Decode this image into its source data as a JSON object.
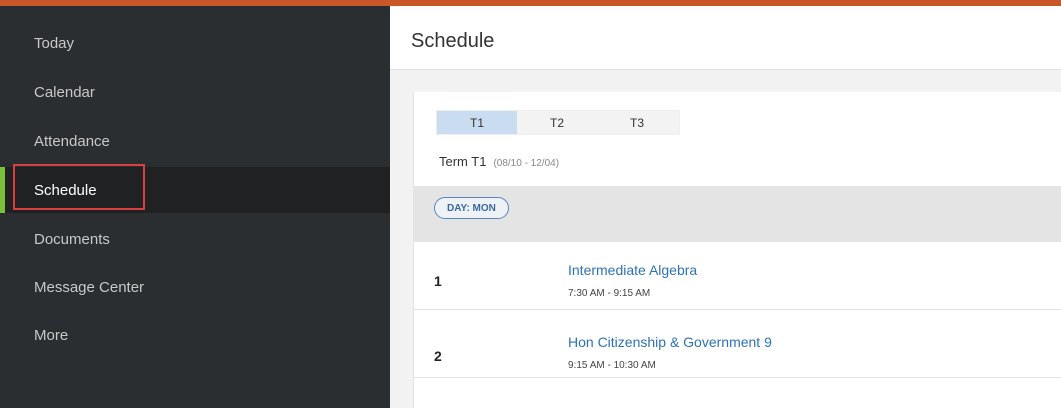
{
  "sidebar": {
    "items": [
      {
        "label": "Today"
      },
      {
        "label": "Calendar"
      },
      {
        "label": "Attendance"
      },
      {
        "label": "Schedule"
      },
      {
        "label": "Documents"
      },
      {
        "label": "Message Center"
      },
      {
        "label": "More"
      }
    ],
    "active_item": "Schedule"
  },
  "header": {
    "title": "Schedule"
  },
  "terms": {
    "tabs": [
      {
        "label": "T1"
      },
      {
        "label": "T2"
      },
      {
        "label": "T3"
      }
    ],
    "selected": "T1",
    "current_term_label": "Term T1",
    "current_term_dates": "(08/10 - 12/04)"
  },
  "day": {
    "label": "DAY: MON"
  },
  "periods": [
    {
      "number": "1",
      "course": "Intermediate Algebra",
      "time": "7:30 AM - 9:15 AM"
    },
    {
      "number": "2",
      "course": "Hon Citizenship & Government 9",
      "time": "9:15 AM - 10:30 AM"
    }
  ],
  "colors": {
    "accent_top_bar": "#c9572a",
    "sidebar_bg": "#2b2e31",
    "active_indicator": "#7bbf3a",
    "highlight_box": "#d94040",
    "link": "#2d72b5",
    "selected_tab": "#c9dcf0"
  }
}
